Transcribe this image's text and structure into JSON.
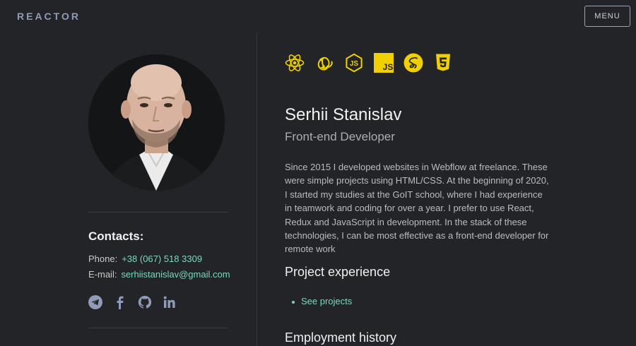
{
  "header": {
    "logo": "REACTOR",
    "menu_label": "MENU"
  },
  "contacts": {
    "title": "Contacts:",
    "phone_label": "Phone:",
    "phone_value": "+38 (067) 518 3309",
    "email_label": "E-mail:",
    "email_value": "serhiistanislav@gmail.com",
    "social_icons": [
      "telegram-icon",
      "facebook-icon",
      "github-icon",
      "linkedin-icon"
    ]
  },
  "techs": [
    "react-icon",
    "redux-icon",
    "nodejs-icon",
    "javascript-icon",
    "sass-icon",
    "html5-icon"
  ],
  "profile": {
    "name": "Serhii Stanislav",
    "role": "Front-end Developer",
    "bio": "Since 2015 I developed websites in Webflow at freelance. These were simple projects using HTML/CSS. At the beginning of 2020, I started my studies at the GoIT school, where I had experience in teamwork and coding for over a year. I prefer to use React, Redux and JavaScript in development. In the stack of these technologies, I can be most effective as a front-end developer for remote work"
  },
  "sections": {
    "projects_title": "Project experience",
    "projects_link": "See projects",
    "employment_title": "Employment history"
  },
  "colors": {
    "background": "#222427",
    "accent": "#7fd6c0",
    "tech_yellow": "#f0d000",
    "logo": "#8f9bb8"
  }
}
